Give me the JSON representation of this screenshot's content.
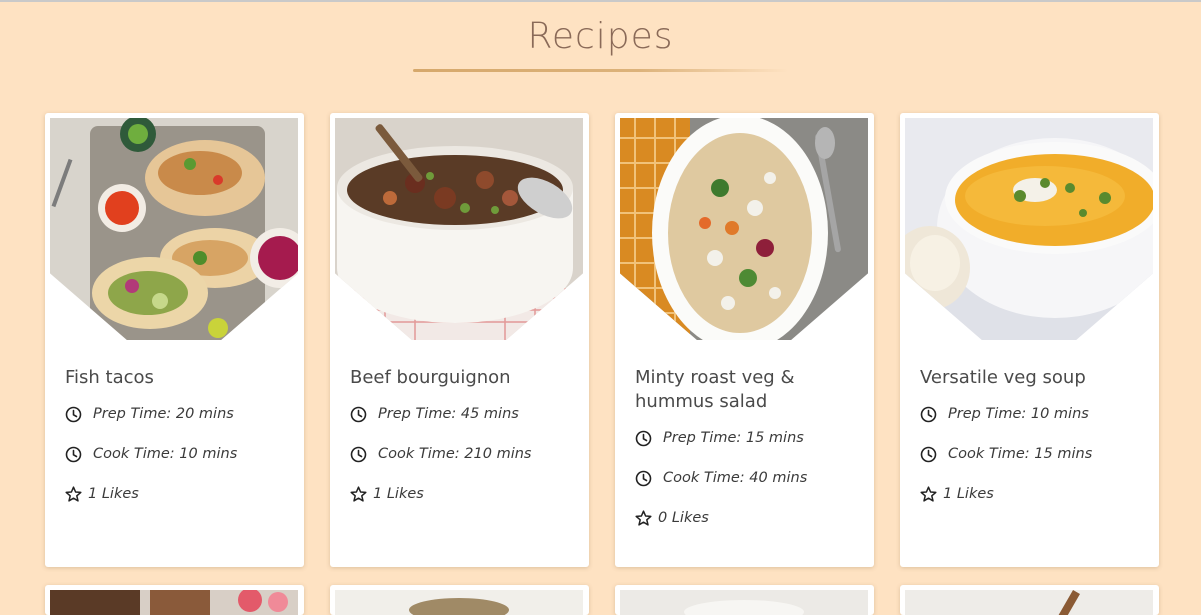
{
  "page": {
    "title": "Recipes"
  },
  "recipes": [
    {
      "name": "Fish tacos",
      "prep": "Prep Time: 20 mins",
      "cook": "Cook Time: 10 mins",
      "likes": "1 Likes"
    },
    {
      "name": "Beef bourguignon",
      "prep": "Prep Time: 45 mins",
      "cook": "Cook Time: 210 mins",
      "likes": "1 Likes"
    },
    {
      "name": "Minty roast veg & hummus salad",
      "prep": "Prep Time: 15 mins",
      "cook": "Cook Time: 40 mins",
      "likes": "0 Likes"
    },
    {
      "name": "Versatile veg soup",
      "prep": "Prep Time: 10 mins",
      "cook": "Cook Time: 15 mins",
      "likes": "1 Likes"
    }
  ],
  "icons": {
    "time": "clock-icon",
    "likes": "star-icon"
  },
  "colors": {
    "background": "#fee2c2",
    "heading": "#8a6a58",
    "underline": "#d6a86b",
    "card": "#ffffff",
    "text": "#3b3b3b"
  }
}
